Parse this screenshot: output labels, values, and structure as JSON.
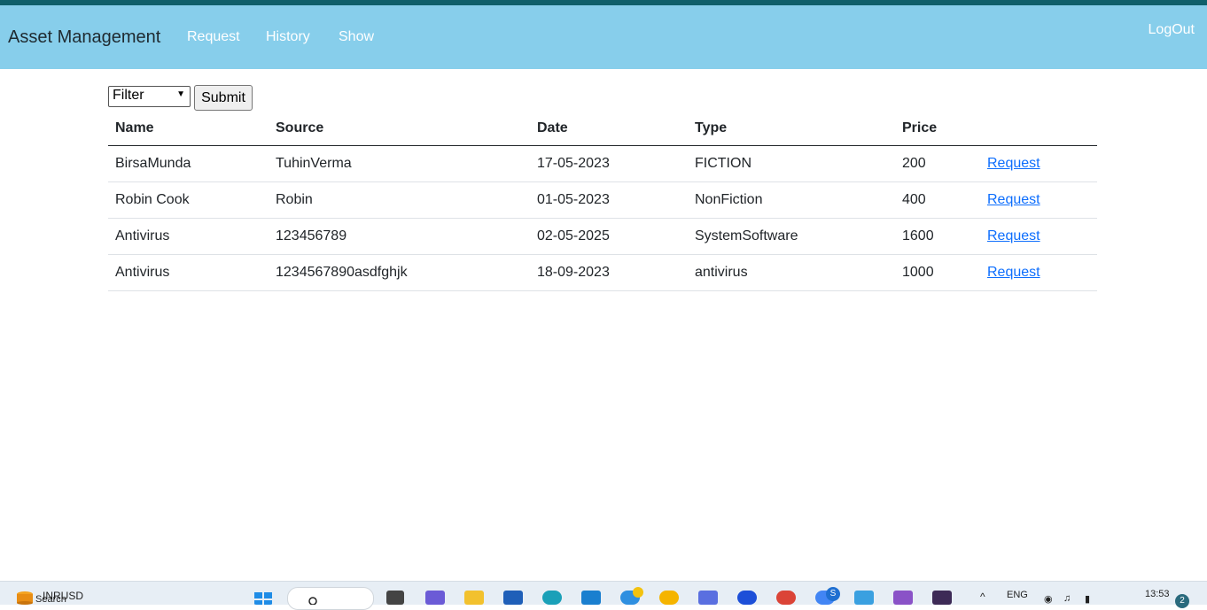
{
  "navbar": {
    "brand": "Asset Management",
    "links": [
      "Request",
      "History",
      "Show"
    ],
    "logout": "LogOut"
  },
  "filter": {
    "selected": "Filter",
    "submit_label": "Submit"
  },
  "table": {
    "headers": [
      "Name",
      "Source",
      "Date",
      "Type",
      "Price"
    ],
    "rows": [
      {
        "name": "BirsaMunda",
        "source": "TuhinVerma",
        "date": "17-05-2023",
        "type": "FICTION",
        "price": "200",
        "action": "Request"
      },
      {
        "name": "Robin Cook",
        "source": "Robin",
        "date": "01-05-2023",
        "type": "NonFiction",
        "price": "400",
        "action": "Request"
      },
      {
        "name": "Antivirus",
        "source": "123456789",
        "date": "02-05-2025",
        "type": "SystemSoftware",
        "price": "1600",
        "action": "Request"
      },
      {
        "name": "Antivirus",
        "source": "1234567890asdfghjk",
        "date": "18-09-2023",
        "type": "antivirus",
        "price": "1000",
        "action": "Request"
      }
    ]
  },
  "taskbar": {
    "ticker": "INRUSD",
    "search": "Search",
    "language": "ENG",
    "time": "13:53",
    "notification_count": "2",
    "chrome_badge": "S"
  },
  "colors": {
    "navbar": "#87ceeb",
    "link": "#0d6efd",
    "topstrip": "#0f5f6a"
  }
}
